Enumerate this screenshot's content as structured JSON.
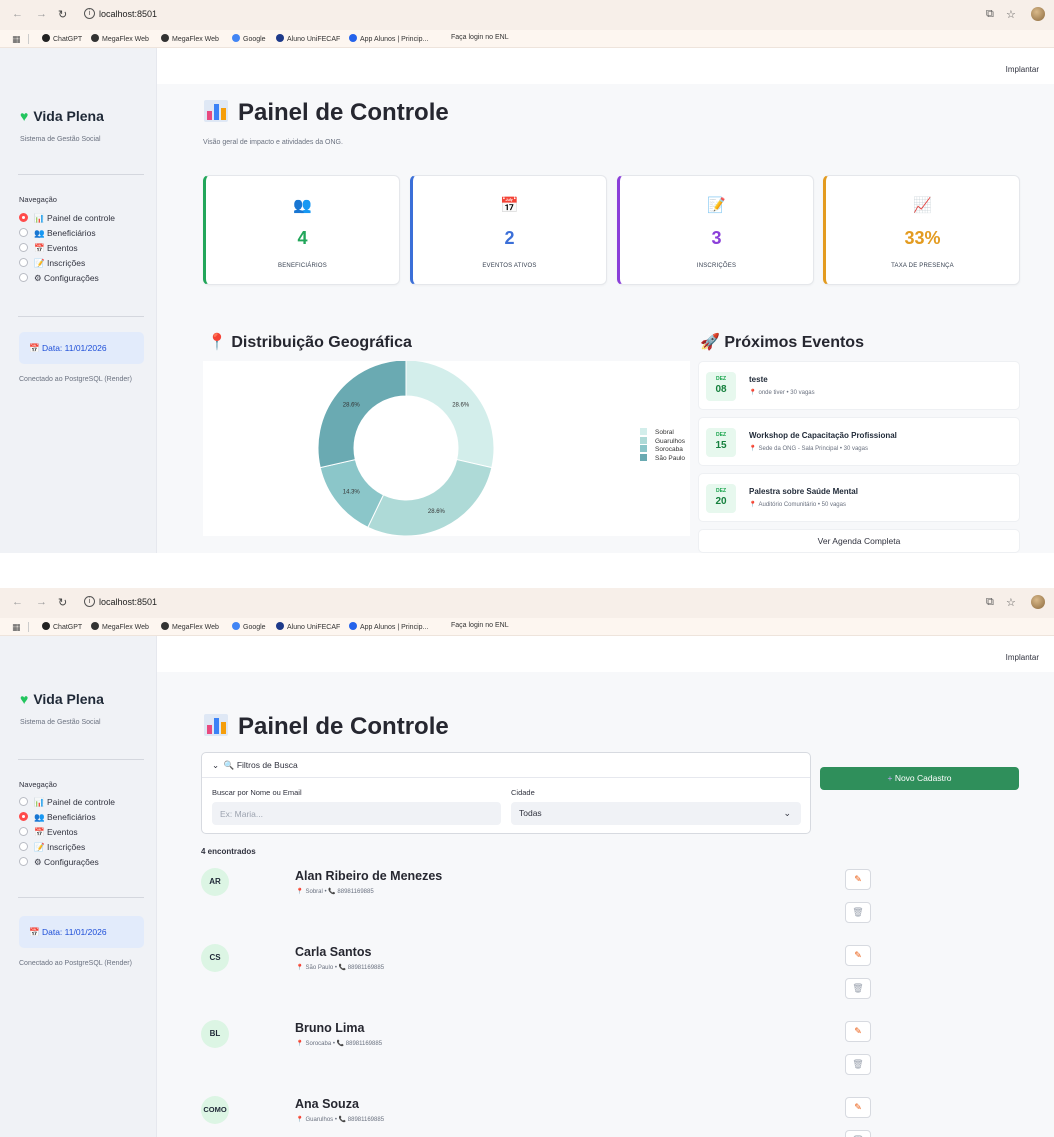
{
  "browser": {
    "url": "localhost:8501",
    "bookmarks": [
      "ChatGPT",
      "MegaFlex Web",
      "MegaFlex Web",
      "Google",
      "Aluno UniFECAF",
      "App Alunos | Princip...",
      "Faça login no ENL"
    ]
  },
  "sidebar": {
    "brand": "Vida Plena",
    "subtitle": "Sistema de Gestão Social",
    "nav_title": "Navegação",
    "items": [
      {
        "label": "Painel de controle",
        "icon": "chart-icon"
      },
      {
        "label": "Beneficiários",
        "icon": "people-icon"
      },
      {
        "label": "Eventos",
        "icon": "calendar-icon"
      },
      {
        "label": "Inscrições",
        "icon": "memo-icon"
      },
      {
        "label": "Configurações",
        "icon": "gear-icon"
      }
    ],
    "date": "Data: 11/01/2026",
    "connection": "Conectado ao PostgreSQL (Render)"
  },
  "topbar": {
    "deploy": "Implantar"
  },
  "dashboard": {
    "title": "Painel de Controle",
    "subtitle": "Visão geral de impacto e atividades da ONG.",
    "cards": [
      {
        "value": "4",
        "label": "BENEFICIÁRIOS",
        "color": "#22a65a",
        "icon": "people-icon"
      },
      {
        "value": "2",
        "label": "EVENTOS ATIVOS",
        "color": "#3b6fd8",
        "icon": "calendar-icon"
      },
      {
        "value": "3",
        "label": "INSCRIÇÕES",
        "color": "#8b3fd9",
        "icon": "memo-icon"
      },
      {
        "value": "33%",
        "label": "TAXA DE PRESENÇA",
        "color": "#e39b20",
        "icon": "chart-up-icon"
      }
    ],
    "geo_title": "Distribuição Geográfica",
    "events_title": "Próximos Eventos",
    "events": [
      {
        "month": "DEZ",
        "day": "08",
        "title": "teste",
        "meta": "onde tiver • 30 vagas"
      },
      {
        "month": "DEZ",
        "day": "15",
        "title": "Workshop de Capacitação Profissional",
        "meta": "Sede da ONG - Sala Principal • 30 vagas"
      },
      {
        "month": "DEZ",
        "day": "20",
        "title": "Palestra sobre Saúde Mental",
        "meta": "Auditório Comunitário • 50 vagas"
      }
    ],
    "agenda_button": "Ver Agenda Completa"
  },
  "chart_data": {
    "type": "pie",
    "donut": true,
    "categories": [
      "Sobral",
      "Guarulhos",
      "Sorocaba",
      "São Paulo"
    ],
    "values": [
      28.6,
      28.6,
      14.3,
      28.6
    ],
    "value_labels": [
      "28.6%",
      "28.6%",
      "14.3%",
      "28.6%"
    ],
    "colors": [
      "#d3eeeb",
      "#aedad7",
      "#8bc6c9",
      "#6aaab2"
    ],
    "legend": "right",
    "title": ""
  },
  "beneficiarios": {
    "title": "Painel de Controle",
    "filter_title": "Filtros de Busca",
    "search_label": "Buscar por Nome ou Email",
    "search_placeholder": "Ex: Maria...",
    "city_label": "Cidade",
    "city_value": "Todas",
    "new_button": "Novo Cadastro",
    "found": "4 encontrados",
    "people": [
      {
        "initials": "AR",
        "name": "Alan Ribeiro de Menezes",
        "city": "Sobral",
        "phone": "88981169885"
      },
      {
        "initials": "CS",
        "name": "Carla Santos",
        "city": "São Paulo",
        "phone": "88981169885"
      },
      {
        "initials": "BL",
        "name": "Bruno Lima",
        "city": "Sorocaba",
        "phone": "88981169885"
      },
      {
        "initials": "COMO",
        "name": "Ana Souza",
        "city": "Guarulhos",
        "phone": "88981169885"
      }
    ]
  }
}
